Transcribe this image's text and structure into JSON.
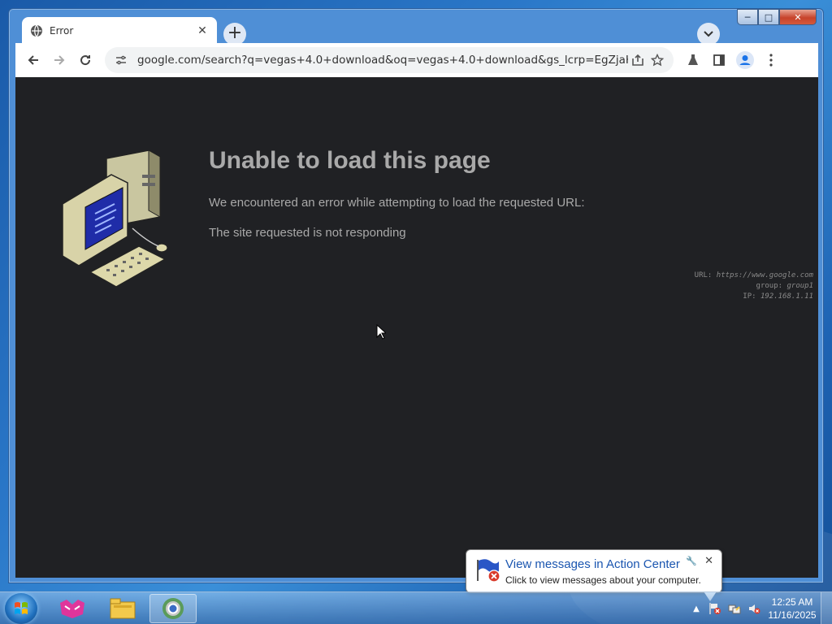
{
  "browser": {
    "tab": {
      "title": "Error",
      "icon": "globe-icon"
    },
    "omnibox": {
      "url": "google.com/search?q=vegas+4.0+download&oq=vegas+4.0+download&gs_lcrp=EgZjaHJvbWUyBggA..."
    }
  },
  "error_page": {
    "title": "Unable to load this page",
    "line1": "We encountered an error while attempting to load the requested URL:",
    "line2": "The site requested is not responding",
    "meta": {
      "url_label": "URL:",
      "url_value": "https://www.google.com",
      "group_label": "group:",
      "group_value": "group1",
      "ip_label": "IP:",
      "ip_value": "192.168.1.11"
    }
  },
  "notification": {
    "title": "View messages in Action Center",
    "subtitle": "Click to view messages about your computer."
  },
  "taskbar": {
    "clock_time": "12:25 AM",
    "clock_date": "11/16/2025"
  },
  "colors": {
    "page_bg": "#202124",
    "error_text": "#a9a9a9",
    "link_blue": "#1b56b0"
  }
}
